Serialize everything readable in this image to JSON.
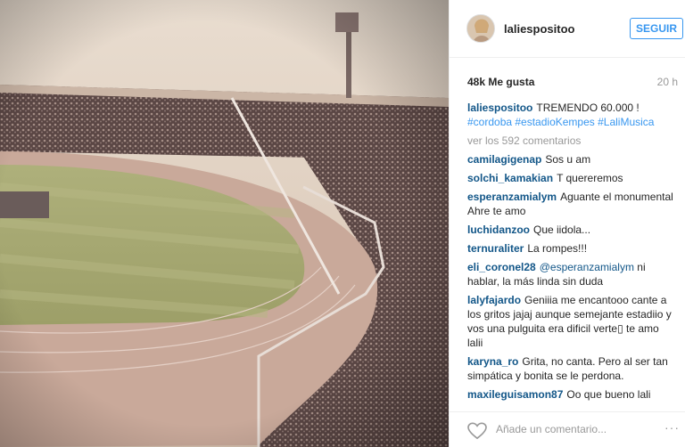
{
  "post": {
    "username": "laliespositoo",
    "follow_label": "SEGUIR",
    "likes": "48k Me gusta",
    "time": "20 h",
    "caption": "TREMENDO 60.000 !",
    "hashtags": "#cordoba #estadioKempes #LaliMusica",
    "view_comments": "ver los 592 comentarios",
    "add_comment_placeholder": "Añade un comentario...",
    "more_label": "···"
  },
  "comments": [
    {
      "user": "camilagigenap",
      "text": "Sos u am"
    },
    {
      "user": "solchi_kamakian",
      "text": "T quereremos"
    },
    {
      "user": "esperanzamialym",
      "text": "Aguante el monumental Ahre te amo"
    },
    {
      "user": "luchidanzoo",
      "text": "Que iidola..."
    },
    {
      "user": "ternuraliter",
      "text": "La rompes!!!"
    },
    {
      "user": "eli_coronel28",
      "mention": "@esperanzamialym",
      "text": " ni hablar, la más linda sin duda"
    },
    {
      "user": "lalyfajardo",
      "text": "Geniiia me encantooo cante a los gritos jajaj aunque semejante estadiio y vos una pulguita era dificil verte▯ te amo lalii"
    },
    {
      "user": "karyna_ro",
      "text": "Grita, no canta. Pero al ser tan simpática y bonita se le perdona."
    },
    {
      "user": "maxileguisamon87",
      "text": "Oo que bueno lali"
    }
  ],
  "colors": {
    "link": "#125688",
    "accent": "#3897f0",
    "muted": "#999999"
  },
  "icons": [
    "heart-icon",
    "more-options-icon",
    "stadium-photo"
  ]
}
